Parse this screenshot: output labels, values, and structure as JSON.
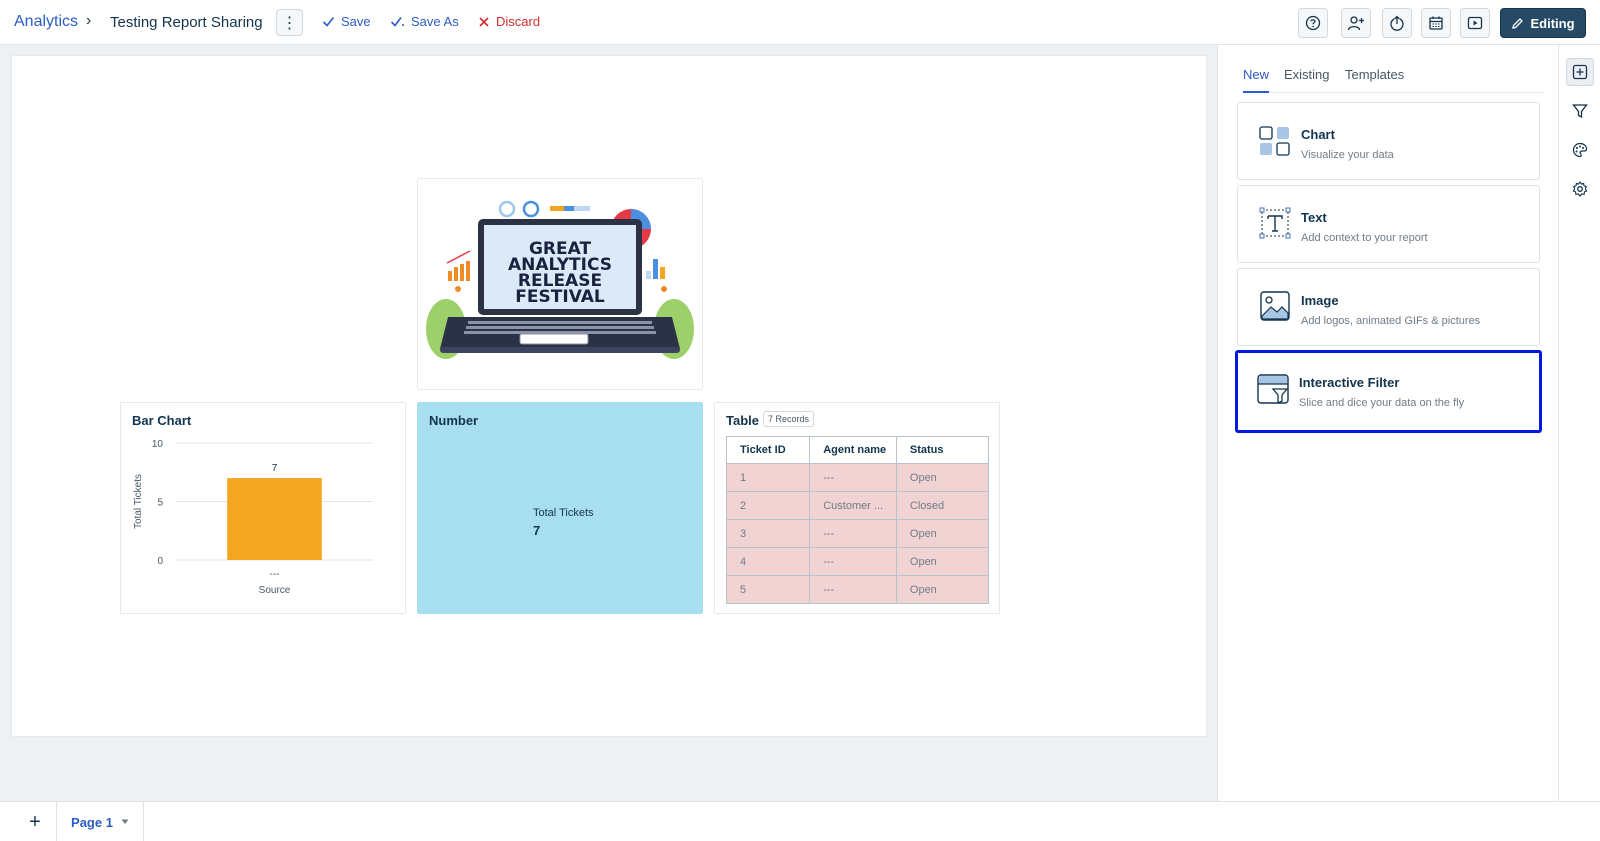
{
  "topbar": {
    "breadcrumb_root": "Analytics",
    "breadcrumb_sep": "›",
    "report_title": "Testing Report Sharing",
    "more_label": "⋮",
    "save_label": "Save",
    "save_as_label": "Save As",
    "discard_label": "Discard",
    "editing_label": "Editing",
    "icons": [
      "help-icon",
      "add-user-icon",
      "export-icon",
      "schedule-icon",
      "present-icon"
    ]
  },
  "canvas": {
    "image_widget": {
      "banner_lines": [
        "GREAT",
        "ANALYTICS",
        "RELEASE",
        "FESTIVAL"
      ]
    },
    "bar_chart_widget": {
      "title": "Bar Chart"
    },
    "number_widget": {
      "title": "Number",
      "metric_label": "Total Tickets",
      "metric_value": "7"
    },
    "table_widget": {
      "title": "Table",
      "records_badge": "7 Records",
      "columns": [
        "Ticket ID",
        "Agent name",
        "Status"
      ],
      "rows": [
        [
          "1",
          "---",
          "Open"
        ],
        [
          "2",
          "Customer ...",
          "Closed"
        ],
        [
          "3",
          "---",
          "Open"
        ],
        [
          "4",
          "---",
          "Open"
        ],
        [
          "5",
          "---",
          "Open"
        ]
      ]
    }
  },
  "chart_data": {
    "type": "bar",
    "categories": [
      "---"
    ],
    "values": [
      7
    ],
    "data_labels": [
      "7"
    ],
    "xlabel": "Source",
    "ylabel": "Total Tickets",
    "ylim": [
      0,
      10
    ],
    "yticks": [
      0,
      5,
      10
    ],
    "grid": true,
    "bar_color": "#f4a522"
  },
  "right_panel": {
    "tabs": [
      "New",
      "Existing",
      "Templates"
    ],
    "active_tab": "New",
    "cards": [
      {
        "title": "Chart",
        "subtitle": "Visualize your data"
      },
      {
        "title": "Text",
        "subtitle": "Add context to your report"
      },
      {
        "title": "Image",
        "subtitle": "Add logos, animated GIFs & pictures"
      },
      {
        "title": "Interactive Filter",
        "subtitle": "Slice and dice your data on the fly"
      }
    ],
    "selected_card": "Interactive Filter",
    "rail_icons": [
      "add-widget-icon",
      "filter-icon",
      "palette-icon",
      "settings-icon"
    ]
  },
  "bottombar": {
    "add_label": "+",
    "page_label": "Page 1"
  },
  "colors": {
    "accent": "#2c5cc5",
    "danger": "#d72d30",
    "editing_bg": "#264966",
    "number_bg": "#a8dff0",
    "table_row_bg": "#f1d3d3",
    "selected_border": "#0018e0"
  }
}
